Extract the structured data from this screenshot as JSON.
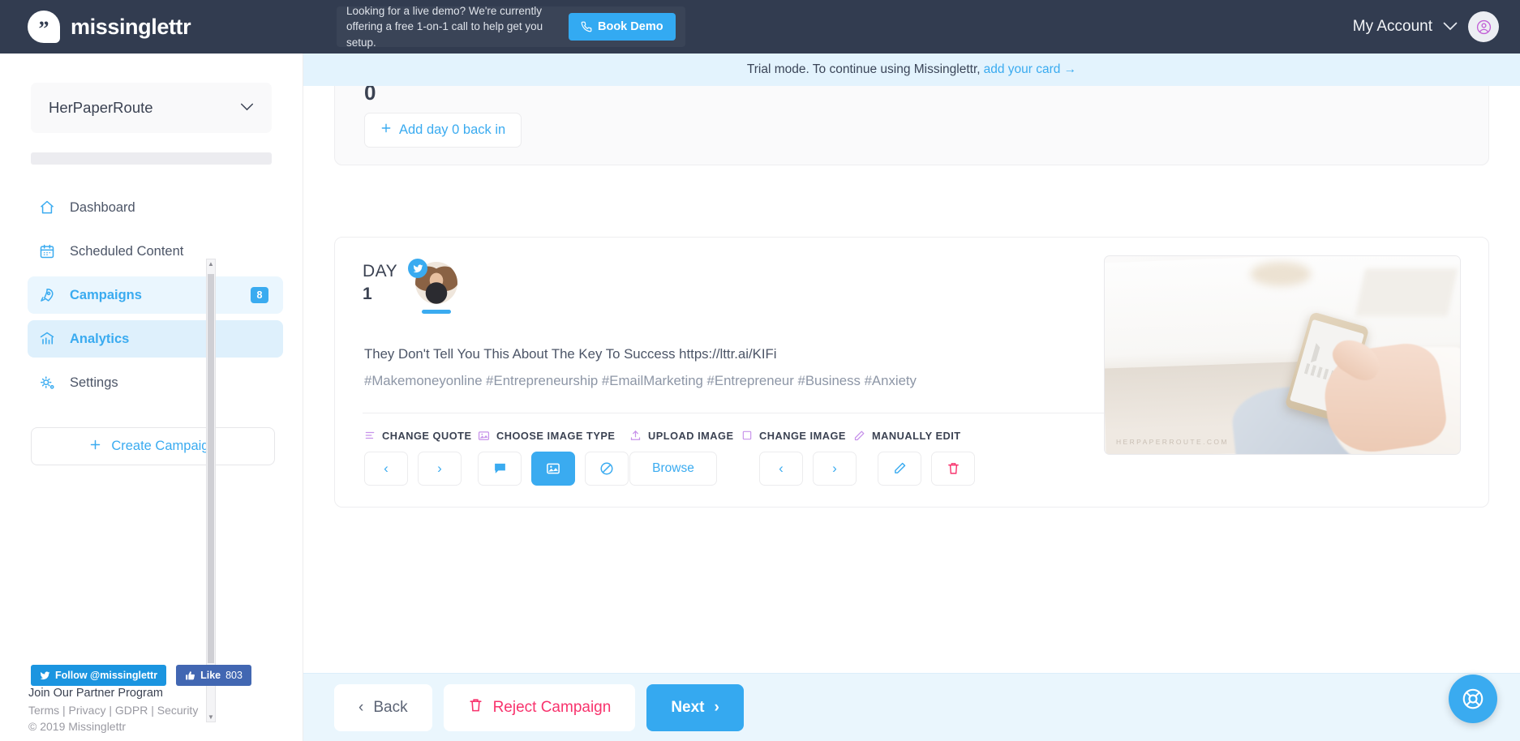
{
  "header": {
    "brand": "missinglettr",
    "brand_mark_glyph": "”",
    "demo_text": "Looking for a live demo? We're currently offering a free 1-on-1 call to help get you setup.",
    "book_demo_label": "Book Demo",
    "account_label": "My Account"
  },
  "trial": {
    "message": "Trial mode. To continue using Missinglettr,",
    "link": "add your card →"
  },
  "sidebar": {
    "account_name": "HerPaperRoute",
    "items": [
      {
        "label": "Dashboard",
        "icon": "home-icon",
        "state": "normal",
        "badge": ""
      },
      {
        "label": "Scheduled Content",
        "icon": "calendar-icon",
        "state": "normal",
        "badge": ""
      },
      {
        "label": "Campaigns",
        "icon": "rocket-icon",
        "state": "active",
        "badge": "8"
      },
      {
        "label": "Analytics",
        "icon": "chart-icon",
        "state": "hover",
        "badge": ""
      },
      {
        "label": "Settings",
        "icon": "gear-icon",
        "state": "normal",
        "badge": ""
      }
    ],
    "create_campaign_label": "Create Campaign",
    "twitter_follow_label": "Follow @missinglettr",
    "facebook_like_label": "Like",
    "facebook_like_count": "803",
    "partner_program": "Join Our Partner Program",
    "legal_links": [
      "Terms",
      "Privacy",
      "GDPR",
      "Security"
    ],
    "copyright": "© 2019 Missinglettr"
  },
  "main": {
    "cut_number": "0",
    "add_day_back_label": "Add day 0 back in",
    "day_word": "DAY",
    "day_number": "1",
    "post_text": "They Don't Tell You This About The Key To Success https://lttr.ai/KIFi",
    "post_tags": "#Makemoneyonline #Entrepreneurship #EmailMarketing #Entrepreneur #Business #Anxiety",
    "image_watermark": "HERPAPERROUTE.COM",
    "tools": [
      {
        "label": "CHANGE QUOTE",
        "icon": "lines-icon"
      },
      {
        "label": "CHOOSE IMAGE TYPE",
        "icon": "picture-icon"
      },
      {
        "label": "UPLOAD IMAGE",
        "icon": "upload-icon"
      },
      {
        "label": "CHANGE IMAGE",
        "icon": "square-icon"
      },
      {
        "label": "MANUALLY EDIT",
        "icon": "pencil-icon"
      }
    ],
    "browse_label": "Browse"
  },
  "bottom": {
    "back_label": "Back",
    "reject_label": "Reject Campaign",
    "next_label": "Next"
  },
  "colors": {
    "brand_blue": "#3aabf0",
    "dark_navy": "#323c50",
    "pink": "#f8336d",
    "purple_icon": "#c792ea"
  }
}
